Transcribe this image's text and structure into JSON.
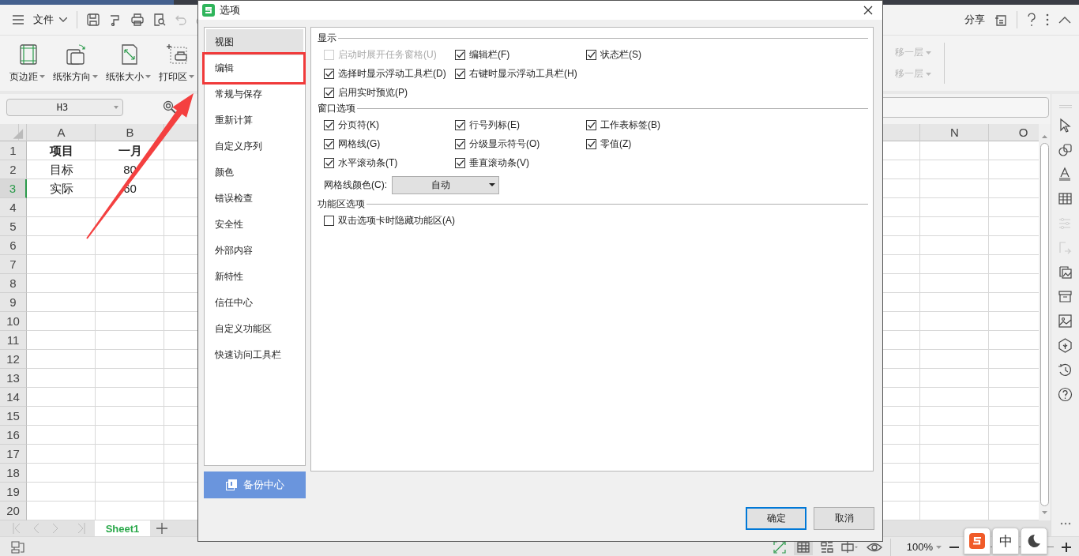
{
  "app": {
    "menu": {
      "label": "文件"
    },
    "ribbon": [
      {
        "label": "页边距"
      },
      {
        "label": "纸张方向"
      },
      {
        "label": "纸张大小"
      },
      {
        "label": "打印区"
      }
    ],
    "ribbon_right": [
      {
        "label": "移一层",
        "disabled": true
      },
      {
        "label": "移一层",
        "disabled": true
      }
    ],
    "share": "分享"
  },
  "name_box": "H3",
  "sheet": {
    "columns": [
      "A",
      "B"
    ],
    "right_columns": [
      "N",
      "O"
    ],
    "rows": [
      {
        "header": "1",
        "selected": false,
        "bold": true,
        "cells": [
          "项目",
          "一月"
        ]
      },
      {
        "header": "2",
        "selected": false,
        "bold": false,
        "cells": [
          "目标",
          "80"
        ]
      },
      {
        "header": "3",
        "selected": true,
        "bold": false,
        "cells": [
          "实际",
          "60"
        ]
      },
      {
        "header": "4",
        "selected": false
      },
      {
        "header": "5",
        "selected": false
      },
      {
        "header": "6",
        "selected": false
      },
      {
        "header": "7",
        "selected": false
      },
      {
        "header": "8",
        "selected": false
      },
      {
        "header": "9",
        "selected": false
      },
      {
        "header": "10",
        "selected": false
      },
      {
        "header": "11",
        "selected": false
      },
      {
        "header": "12",
        "selected": false
      },
      {
        "header": "13",
        "selected": false
      },
      {
        "header": "14",
        "selected": false
      },
      {
        "header": "15",
        "selected": false
      },
      {
        "header": "16",
        "selected": false
      },
      {
        "header": "17",
        "selected": false
      },
      {
        "header": "18",
        "selected": false
      },
      {
        "header": "19",
        "selected": false
      },
      {
        "header": "20",
        "selected": false
      }
    ]
  },
  "sheet_tabs": [
    {
      "label": "Sheet1",
      "selected": true
    }
  ],
  "status_bar": {
    "zoom": "100%"
  },
  "ime": {
    "mode": "中"
  },
  "dialog": {
    "title": "选项",
    "nav": [
      {
        "label": "视图",
        "selected": true,
        "highlighted": false
      },
      {
        "label": "编辑",
        "selected": false,
        "highlighted": true
      },
      {
        "label": "常规与保存",
        "selected": false,
        "highlighted": false
      },
      {
        "label": "重新计算",
        "selected": false,
        "highlighted": false
      },
      {
        "label": "自定义序列",
        "selected": false,
        "highlighted": false
      },
      {
        "label": "颜色",
        "selected": false,
        "highlighted": false
      },
      {
        "label": "错误检查",
        "selected": false,
        "highlighted": false
      },
      {
        "label": "安全性",
        "selected": false,
        "highlighted": false
      },
      {
        "label": "外部内容",
        "selected": false,
        "highlighted": false
      },
      {
        "label": "新特性",
        "selected": false,
        "highlighted": false
      },
      {
        "label": "信任中心",
        "selected": false,
        "highlighted": false
      },
      {
        "label": "自定义功能区",
        "selected": false,
        "highlighted": false
      },
      {
        "label": "快速访问工具栏",
        "selected": false,
        "highlighted": false
      }
    ],
    "backup_button": "备份中心",
    "sections": [
      {
        "title": "显示",
        "rows": [
          [
            {
              "label": "启动时展开任务窗格(U)",
              "checked": false,
              "disabled": true
            },
            {
              "label": "编辑栏(F)",
              "checked": true,
              "disabled": false
            },
            {
              "label": "状态栏(S)",
              "checked": true,
              "disabled": false
            }
          ],
          [
            {
              "label": "选择时显示浮动工具栏(D)",
              "checked": true,
              "disabled": false
            },
            {
              "label": "右键时显示浮动工具栏(H)",
              "checked": true,
              "disabled": false
            }
          ],
          [
            {
              "label": "启用实时预览(P)",
              "checked": true,
              "disabled": false
            }
          ]
        ]
      },
      {
        "title": "窗口选项",
        "rows": [
          [
            {
              "label": "分页符(K)",
              "checked": true,
              "disabled": false
            },
            {
              "label": "行号列标(E)",
              "checked": true,
              "disabled": false
            },
            {
              "label": "工作表标签(B)",
              "checked": true,
              "disabled": false
            }
          ],
          [
            {
              "label": "网格线(G)",
              "checked": true,
              "disabled": false
            },
            {
              "label": "分级显示符号(O)",
              "checked": true,
              "disabled": false
            },
            {
              "label": "零值(Z)",
              "checked": true,
              "disabled": false
            }
          ],
          [
            {
              "label": "水平滚动条(T)",
              "checked": true,
              "disabled": false
            },
            {
              "label": "垂直滚动条(V)",
              "checked": true,
              "disabled": false
            }
          ]
        ],
        "dropdown": {
          "label": "网格线颜色(C):",
          "value": "自动"
        }
      },
      {
        "title": "功能区选项",
        "rows": [
          [
            {
              "label": "双击选项卡时隐藏功能区(A)",
              "checked": false,
              "disabled": false
            }
          ]
        ]
      }
    ],
    "buttons": [
      {
        "label": "确定",
        "default": true
      },
      {
        "label": "取消",
        "default": false
      }
    ]
  }
}
